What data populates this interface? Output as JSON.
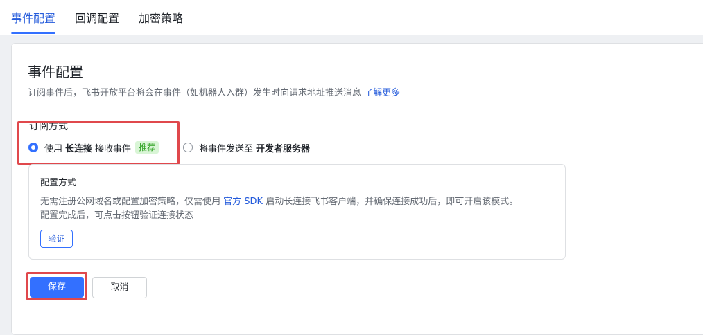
{
  "tabs": [
    {
      "label": "事件配置",
      "active": true
    },
    {
      "label": "回调配置",
      "active": false
    },
    {
      "label": "加密策略",
      "active": false
    }
  ],
  "section": {
    "title": "事件配置",
    "description": "订阅事件后，飞书开放平台将会在事件（如机器人入群）发生时向请求地址推送消息",
    "learn_more": "了解更多"
  },
  "subscription": {
    "label": "订阅方式",
    "options": [
      {
        "prefix": "使用",
        "bold": "长连接",
        "suffix": "接收事件",
        "badge": "推荐",
        "checked": true
      },
      {
        "prefix": "将事件发送至",
        "bold": "开发者服务器",
        "suffix": "",
        "badge": "",
        "checked": false
      }
    ]
  },
  "config": {
    "title": "配置方式",
    "line1_before": "无需注册公网域名或配置加密策略，仅需使用",
    "line1_link": "官方 SDK",
    "line1_after": "启动长连接飞书客户端，并确保连接成功后，即可开启该模式。",
    "line2": "配置完成后，可点击按钮验证连接状态",
    "verify_label": "验证"
  },
  "actions": {
    "save_label": "保存",
    "cancel_label": "取消"
  },
  "colors": {
    "accent": "#3370ff",
    "highlight": "#e0484c",
    "badge_bg": "#d9f5d6",
    "badge_text": "#2ea121"
  }
}
